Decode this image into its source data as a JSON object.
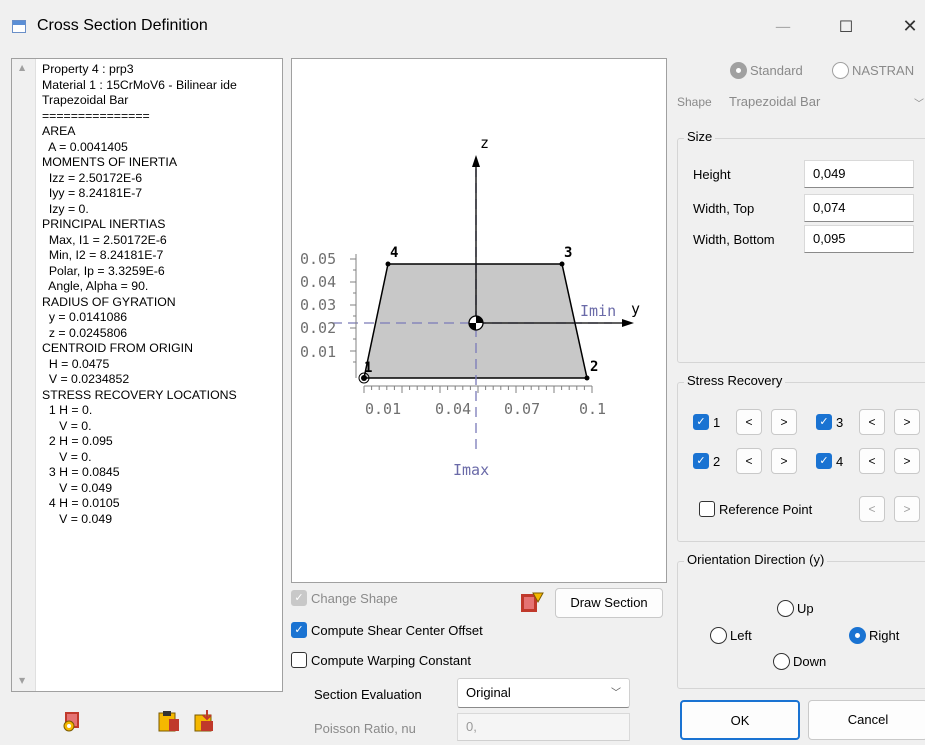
{
  "window": {
    "title": "Cross Section Definition",
    "minimize_glyph": "—",
    "maximize_glyph": "☐",
    "close_glyph": "✕"
  },
  "properties": {
    "lines": [
      "Property 4 : prp3",
      "Material 1 : 15CrMoV6 - Bilinear ide",
      "Trapezoidal Bar",
      "===============",
      "AREA",
      "  A = 0.0041405",
      "MOMENTS OF INERTIA",
      "  Izz = 2.50172E-6",
      "  Iyy = 8.24181E-7",
      "  Izy = 0.",
      "PRINCIPAL INERTIAS",
      "  Max, I1 = 2.50172E-6",
      "  Min, I2 = 8.24181E-7",
      "  Polar, Ip = 3.3259E-6",
      "  Angle, Alpha = 90.",
      "RADIUS OF GYRATION",
      "  y = 0.0141086",
      "  z = 0.0245806",
      "CENTROID FROM ORIGIN",
      "  H = 0.0475",
      "  V = 0.0234852",
      "STRESS RECOVERY LOCATIONS",
      "  1 H = 0.",
      "     V = 0.",
      "  2 H = 0.095",
      "     V = 0.",
      "  3 H = 0.0845",
      "     V = 0.049",
      "  4 H = 0.0105",
      "     V = 0.049"
    ]
  },
  "drawing": {
    "axis_z": "z",
    "axis_y": "y",
    "imin": "Imin",
    "imax": "Imax",
    "y_ticks": [
      "0.05",
      "0.04",
      "0.03",
      "0.02",
      "0.01"
    ],
    "x_ticks": [
      "0.01",
      "0.04",
      "0.07",
      "0.1"
    ],
    "corners": [
      "1",
      "2",
      "3",
      "4"
    ]
  },
  "canvas_controls": {
    "change_shape": "Change Shape",
    "draw_section": "Draw Section",
    "shear_center": "Compute Shear Center Offset",
    "warping": "Compute Warping Constant",
    "section_eval_label": "Section Evaluation",
    "section_eval_value": "Original",
    "poisson_label": "Poisson Ratio, nu",
    "poisson_value": "0,"
  },
  "format": {
    "standard": "Standard",
    "nastran": "NASTRAN",
    "shape_label": "Shape",
    "shape_value": "Trapezoidal Bar"
  },
  "size": {
    "title": "Size",
    "height_label": "Height",
    "height_value": "0,049",
    "width_top_label": "Width, Top",
    "width_top_value": "0,074",
    "width_bottom_label": "Width, Bottom",
    "width_bottom_value": "0,095"
  },
  "stress": {
    "title": "Stress Recovery",
    "p1": "1",
    "p2": "2",
    "p3": "3",
    "p4": "4",
    "prev": "<",
    "next": ">",
    "reference_point": "Reference Point"
  },
  "orientation": {
    "title": "Orientation Direction (y)",
    "up": "Up",
    "left": "Left",
    "right": "Right",
    "down": "Down"
  },
  "buttons": {
    "ok": "OK",
    "cancel": "Cancel"
  },
  "colors": {
    "accent": "#1a73d2",
    "axis": "#7a7ab8",
    "section_fill": "#c8c8c8"
  }
}
